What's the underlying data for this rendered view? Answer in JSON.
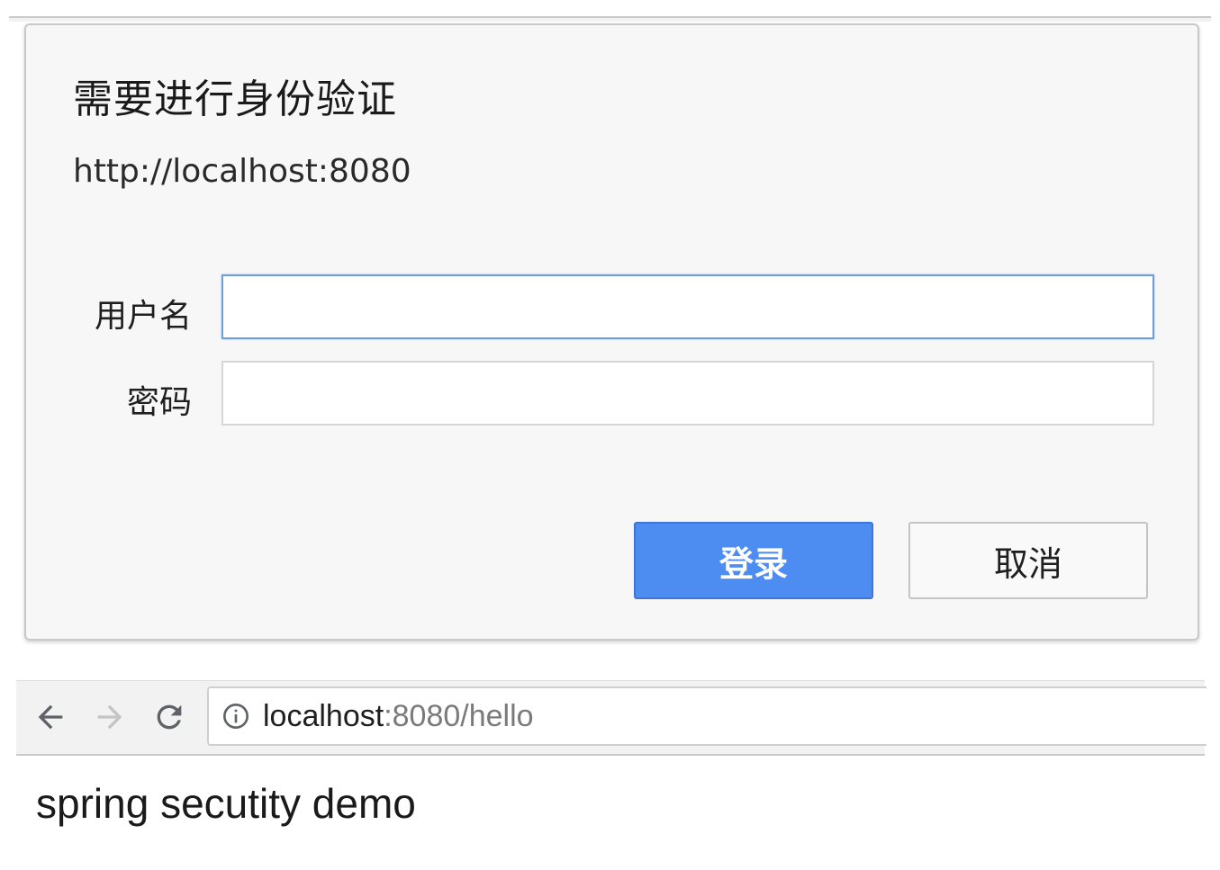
{
  "dialog": {
    "title": "需要进行身份验证",
    "origin": "http://localhost:8080",
    "username_label": "用户名",
    "username_value": "",
    "password_label": "密码",
    "password_value": "",
    "login_label": "登录",
    "cancel_label": "取消"
  },
  "browser": {
    "back_icon": "arrow-left-icon",
    "forward_icon": "arrow-right-icon",
    "reload_icon": "reload-icon",
    "info_icon": "info-icon",
    "url_host": "localhost",
    "url_rest": ":8080/hello"
  },
  "page": {
    "body_text": "spring secutity demo"
  },
  "colors": {
    "primary_button": "#4d8cf0",
    "focus_border": "#6fa0d8",
    "dialog_bg": "#f7f7f7"
  }
}
